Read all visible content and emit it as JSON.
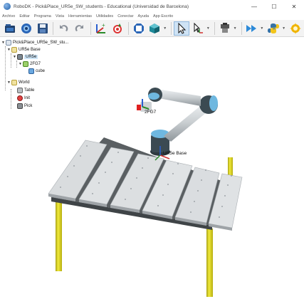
{
  "window": {
    "title": "RoboDK - Pick&Place_UR5e_SW_students - Educational (Universidad de Barcelona)",
    "controls": [
      "—",
      "☐",
      "✕"
    ]
  },
  "menu": [
    "Archivo",
    "Editar",
    "Programa",
    "Vista",
    "Herramientas",
    "Utilidades",
    "Conectar",
    "Ayuda",
    "App Escrito"
  ],
  "toolbar": {
    "buttons": [
      "open-icon",
      "web-icon",
      "save-icon",
      "undo-icon",
      "redo-icon",
      "add-target-icon",
      "teach-target-icon",
      "fit-view-icon",
      "iso-view-icon",
      "select-icon",
      "move-reference-icon",
      "program-icon",
      "run-icon",
      "python-icon",
      "options-icon"
    ]
  },
  "tree": {
    "station": "Pick&Place_UR5e_SW_stu...",
    "base": "UR5e Base",
    "robot": "UR5e",
    "tool": "2FG7",
    "cube": "cube",
    "world": "World",
    "table": "Table",
    "init": "Init",
    "pick": "Pick"
  },
  "scene": {
    "tool_label": "2FG7",
    "base_label": "UR5e Base",
    "colors": {
      "table_top": "#d9dcde",
      "table_frame": "#5a5f62",
      "legs": "#d9d21c",
      "robot_link": "#c9ced1",
      "robot_joint": "#3b4a52",
      "joint_ring": "#6fb8e0"
    }
  }
}
